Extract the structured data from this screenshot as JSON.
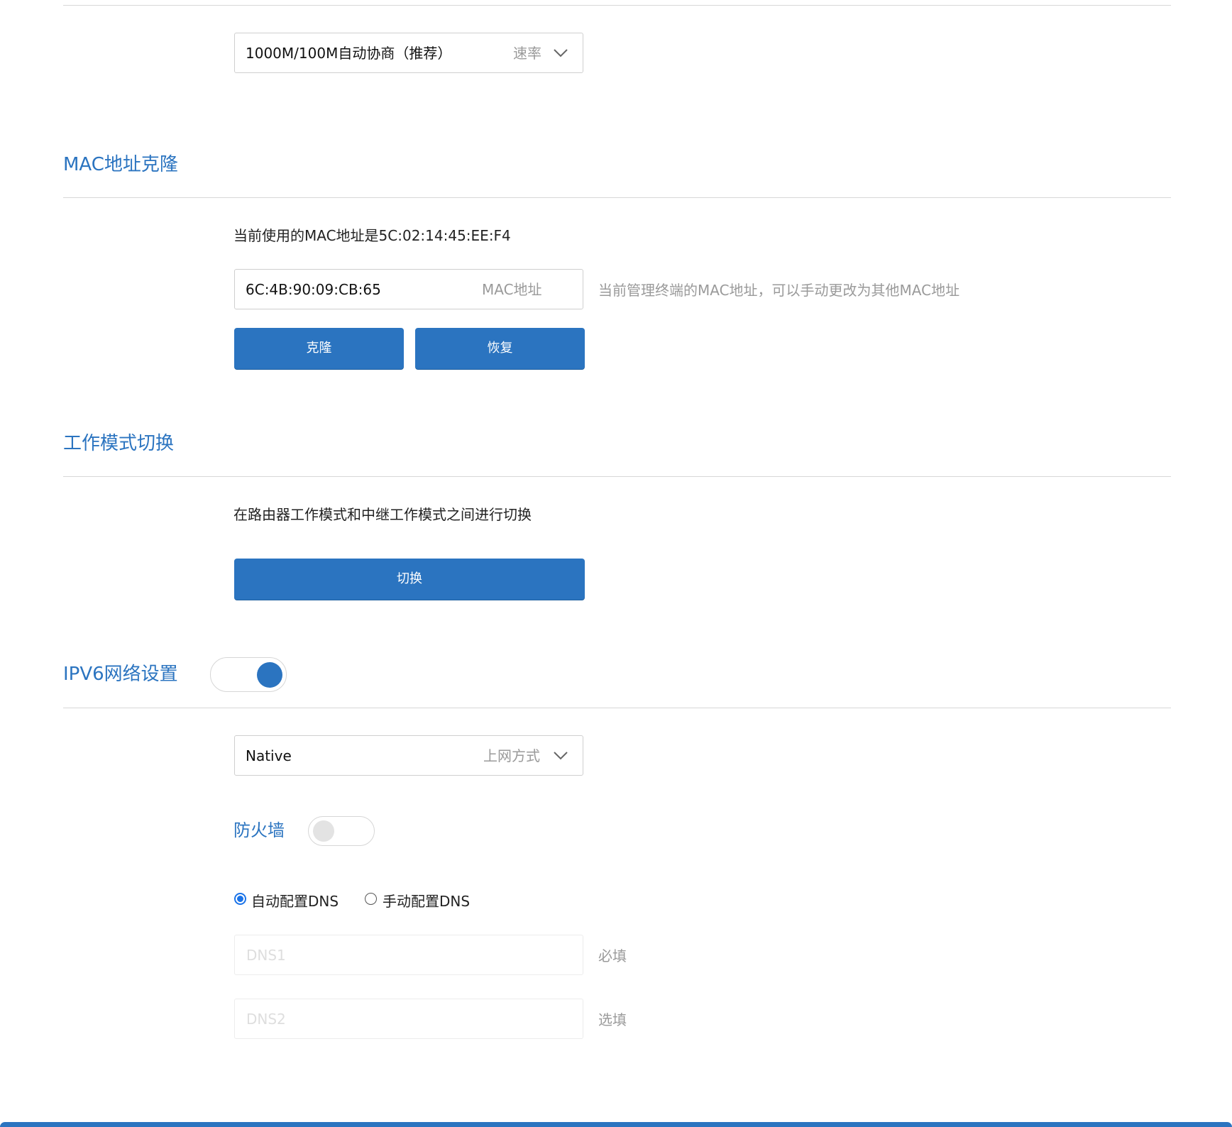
{
  "speed": {
    "value": "1000M/100M自动协商（推荐）",
    "hint": "速率"
  },
  "mac_clone": {
    "title": "MAC地址克隆",
    "current_text": "当前使用的MAC地址是5C:02:14:45:EE:F4",
    "input_value": "6C:4B:90:09:CB:65",
    "input_hint": "MAC地址",
    "side_note": "当前管理终端的MAC地址，可以手动更改为其他MAC地址",
    "clone_label": "克隆",
    "restore_label": "恢复"
  },
  "work_mode": {
    "title": "工作模式切换",
    "description": "在路由器工作模式和中继工作模式之间进行切换",
    "switch_label": "切换"
  },
  "ipv6": {
    "title": "IPV6网络设置",
    "enabled": true,
    "connection_value": "Native",
    "connection_hint": "上网方式",
    "firewall_label": "防火墙",
    "firewall_enabled": false,
    "dns_auto_label": "自动配置DNS",
    "dns_manual_label": "手动配置DNS",
    "dns_selected": "auto",
    "dns1_placeholder": "DNS1",
    "dns1_note": "必填",
    "dns2_placeholder": "DNS2",
    "dns2_note": "选填"
  },
  "colors": {
    "accent": "#2b74c0",
    "rule": "#d7d7d7",
    "hint": "#9a9a9a"
  }
}
